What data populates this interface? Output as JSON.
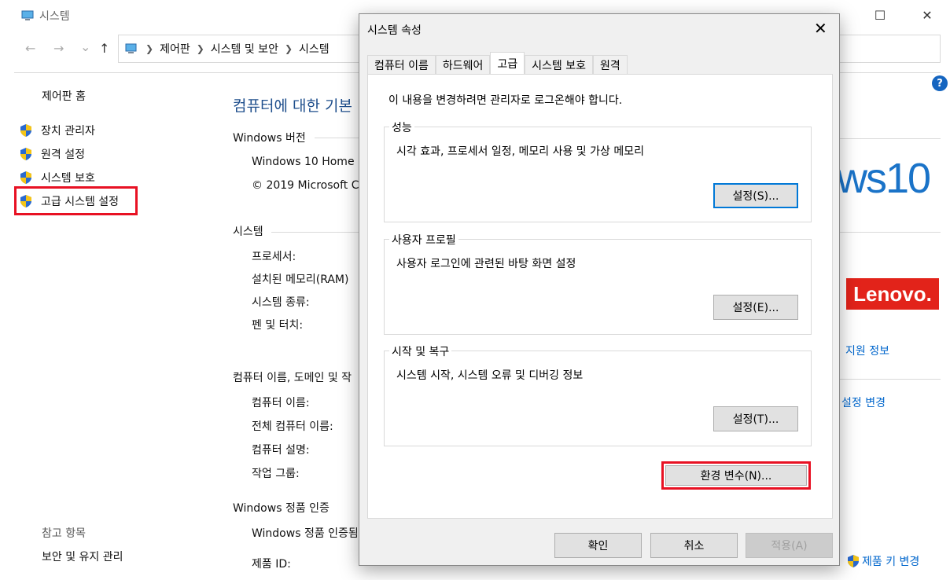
{
  "window": {
    "title": "시스템",
    "minimize": "—",
    "maximize": "☐",
    "close": "✕"
  },
  "nav": {
    "back": "←",
    "forward": "→",
    "dropdown": "⌄",
    "up": "↑"
  },
  "breadcrumb": [
    "제어판",
    "시스템 및 보안",
    "시스템"
  ],
  "sidebar": {
    "home": "제어판 홈",
    "items": [
      {
        "label": "장치 관리자"
      },
      {
        "label": "원격 설정"
      },
      {
        "label": "시스템 보호"
      },
      {
        "label": "고급 시스템 설정"
      }
    ],
    "see_also": "참고 항목",
    "security": "보안 및 유지 관리"
  },
  "main": {
    "heading": "컴퓨터에 대한 기본",
    "windows_edition_header": "Windows 버전",
    "edition": "Windows 10 Home",
    "copyright": "© 2019 Microsoft C",
    "system_header": "시스템",
    "processor": "프로세서:",
    "ram": "설치된 메모리(RAM)",
    "system_type": "시스템 종류:",
    "pen_touch": "펜 및 터치:",
    "computer_header": "컴퓨터 이름, 도메인 및 작",
    "computer_name": "컴퓨터 이름:",
    "full_name": "전체 컴퓨터 이름:",
    "description": "컴퓨터 설명:",
    "workgroup": "작업 그룹:",
    "activation_header": "Windows 정품 인증",
    "activation_text": "Windows 정품 인증됨",
    "product_id": "제품 ID:",
    "windows_logo": "ws10",
    "lenovo": "Lenovo.",
    "support_link": "지원 정보",
    "change_settings": "설정 변경",
    "change_key": "제품 키 변경",
    "help_icon": "?"
  },
  "dialog": {
    "title": "시스템 속성",
    "close": "✕",
    "tabs": [
      "컴퓨터 이름",
      "하드웨어",
      "고급",
      "시스템 보호",
      "원격"
    ],
    "admin_note": "이 내용을 변경하려면 관리자로 로그온해야 합니다.",
    "performance": {
      "label": "성능",
      "desc": "시각 효과, 프로세서 일정, 메모리 사용 및 가상 메모리",
      "button": "설정(S)..."
    },
    "profiles": {
      "label": "사용자 프로필",
      "desc": "사용자 로그인에 관련된 바탕 화면 설정",
      "button": "설정(E)..."
    },
    "startup": {
      "label": "시작 및 복구",
      "desc": "시스템 시작, 시스템 오류 및 디버깅 정보",
      "button": "설정(T)..."
    },
    "env_button": "환경 변수(N)...",
    "ok": "확인",
    "cancel": "취소",
    "apply": "적용(A)"
  },
  "colors": {
    "highlight": "#e81123",
    "link": "#0066cc",
    "heading": "#1e4e8c"
  }
}
